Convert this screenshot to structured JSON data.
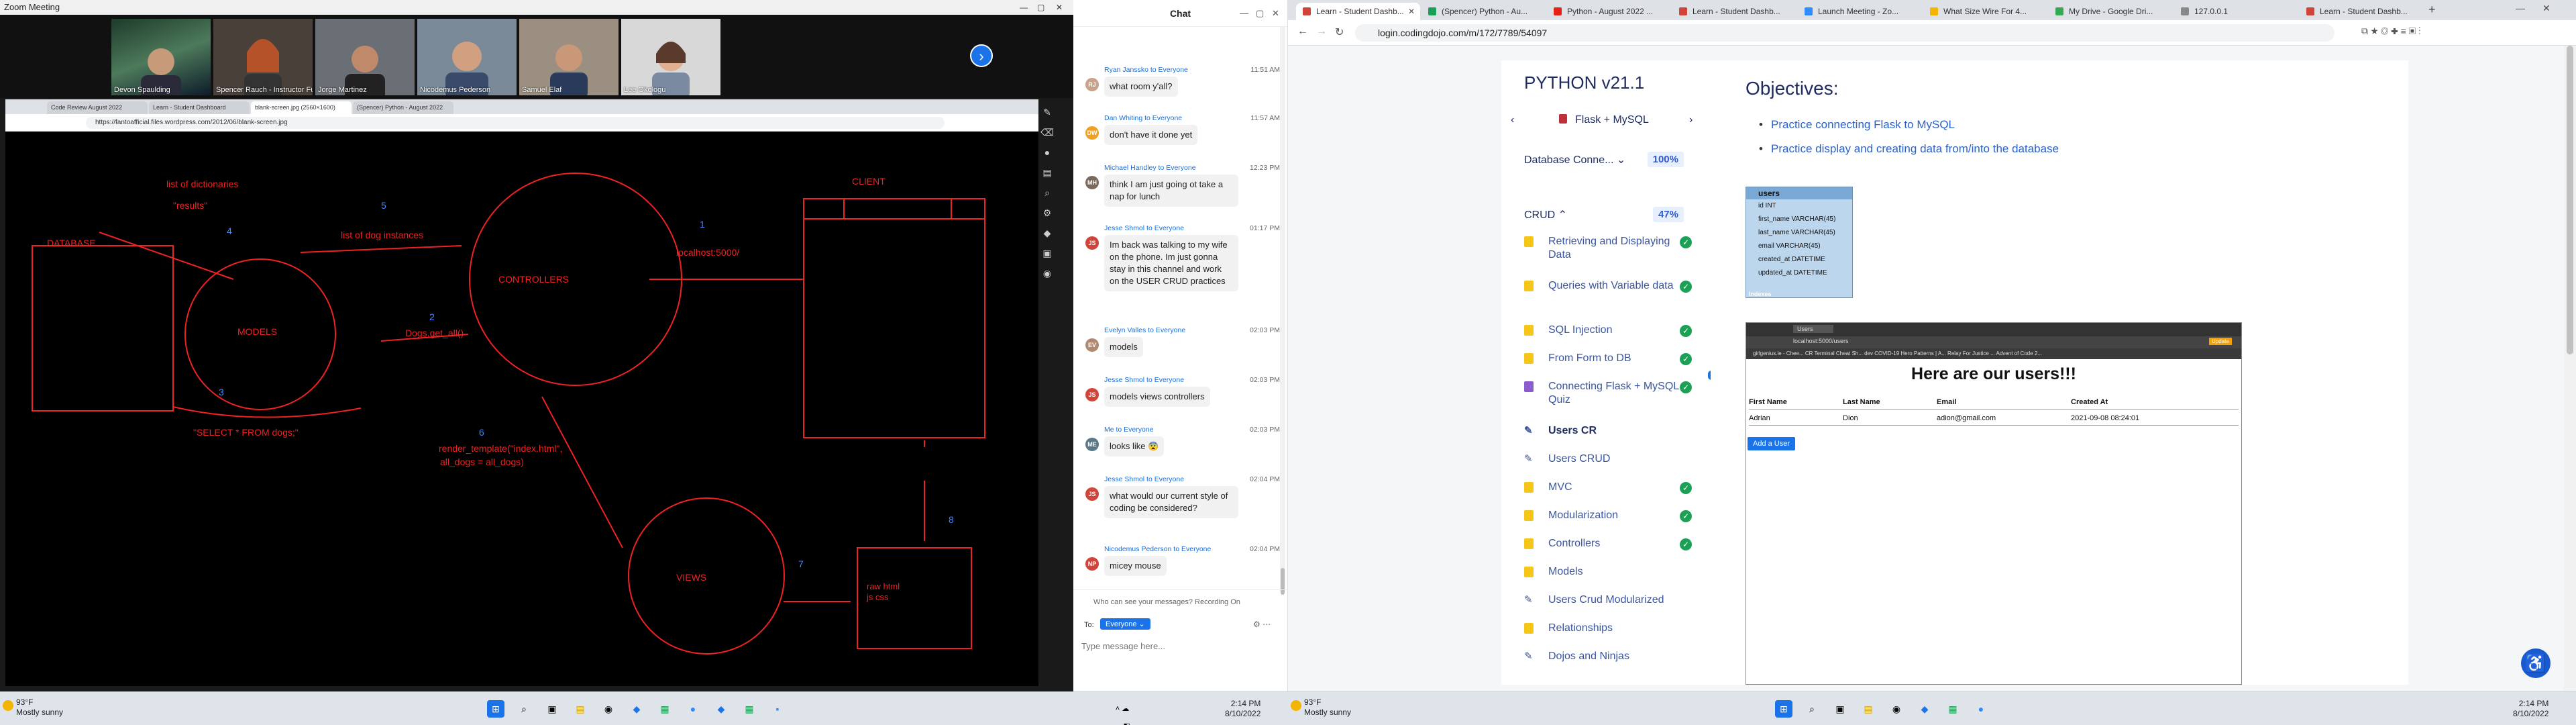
{
  "zoom": {
    "title": "Zoom Meeting",
    "participants": [
      "Devon Spaulding",
      "Spencer Rauch - Instructor Full-Ti...",
      "Jorge Martinez",
      "Nicodemus Pederson",
      "Samuel Elaf",
      "Lee Okologu"
    ]
  },
  "share": {
    "tabs": [
      "Code Review August 2022",
      "Learn - Student Dashboard",
      "blank-screen.jpg (2560×1600)",
      "(Spencer) Python - August 2022"
    ],
    "url": "https://fantoafficial.files.wordpress.com/2012/06/blank-screen.jpg"
  },
  "diagram": {
    "labels": [
      "DATABASE",
      "list of dictionaries",
      "\"results\"",
      "4",
      "5",
      "list  of dog instances",
      "MODELS",
      "CONTROLLERS",
      "1",
      "localhost:5000/",
      "CLIENT",
      "2",
      "Dogs.get_all()",
      "3",
      "\"SELECT * FROM dogs;\"",
      "6",
      "render_template(\"index.html\",",
      "all_dogs = all_dogs)",
      "VIEWS",
      "7",
      "8",
      "raw html  js  css"
    ]
  },
  "chat": {
    "title": "Chat",
    "messages": [
      {
        "from": "Ryan Janssko to Everyone",
        "time": "11:51 AM",
        "initials": "RJ",
        "text": "what room y'all?"
      },
      {
        "from": "Dan Whiting to Everyone",
        "time": "11:57 AM",
        "initials": "DW",
        "text": "don't have it done yet"
      },
      {
        "from": "Michael Handley to Everyone",
        "time": "12:23 PM",
        "initials": "MH",
        "text": "think I am just going ot take a nap for lunch"
      },
      {
        "from": "Jesse Shmol to Everyone",
        "time": "01:17 PM",
        "initials": "JS",
        "text": "Im back was talking to my wife on the phone. Im just gonna stay in this channel and work on the USER CRUD practices"
      },
      {
        "from": "Evelyn Valles to Everyone",
        "time": "02:03 PM",
        "initials": "EV",
        "text": "models"
      },
      {
        "from": "Jesse Shmol to Everyone",
        "time": "02:03 PM",
        "initials": "JS",
        "text": "models views controllers"
      },
      {
        "from": "Me to Everyone",
        "time": "02:03 PM",
        "initials": "ME",
        "text": "looks like 😨"
      },
      {
        "from": "Jesse Shmol to Everyone",
        "time": "02:04 PM",
        "initials": "JS",
        "text": "what would our current style of coding be considered?"
      },
      {
        "from": "Nicodemus Pederson to Everyone",
        "time": "02:04 PM",
        "initials": "NP",
        "text": "micey mouse"
      }
    ],
    "visibility_note": "Who can see your messages? Recording On",
    "to_label": "To:",
    "recipient": "Everyone ⌄",
    "placeholder": "Type message here..."
  },
  "browser": {
    "tabs": [
      "Learn - Student Dashb...",
      "(Spencer) Python - Au...",
      "Python - August 2022 ...",
      "Learn - Student Dashb...",
      "Launch Meeting - Zo...",
      "What Size Wire For 4...",
      "My Drive - Google Dri...",
      "127.0.0.1",
      "Learn - Student Dashb..."
    ],
    "url": "login.codingdojo.com/m/172/7789/54097"
  },
  "learn": {
    "course_title": "PYTHON v21.1",
    "section_title": "Flask + MySQL",
    "chapters": [
      {
        "title": "Database Conne... ⌄",
        "progress": "100%"
      },
      {
        "title": "CRUD ⌃",
        "progress": "47%"
      }
    ],
    "lessons": [
      {
        "title": "Retrieving and Displaying Data",
        "type": "doc",
        "done": true
      },
      {
        "title": "Queries with Variable data",
        "type": "doc",
        "done": true
      },
      {
        "title": "SQL Injection",
        "type": "doc",
        "done": true
      },
      {
        "title": "From Form to DB",
        "type": "doc",
        "done": true
      },
      {
        "title": "Connecting Flask + MySQL Quiz",
        "type": "quiz",
        "done": true
      },
      {
        "title": "Users CR",
        "type": "assignment",
        "done": false,
        "active": true
      },
      {
        "title": "Users CRUD",
        "type": "assignment",
        "done": false
      },
      {
        "title": "MVC",
        "type": "doc",
        "done": true
      },
      {
        "title": "Modularization",
        "type": "doc",
        "done": true
      },
      {
        "title": "Controllers",
        "type": "doc",
        "done": true
      },
      {
        "title": "Models",
        "type": "doc",
        "done": false
      },
      {
        "title": "Users Crud Modularized",
        "type": "assignment",
        "done": false
      },
      {
        "title": "Relationships",
        "type": "doc",
        "done": false
      },
      {
        "title": "Dojos and Ninjas",
        "type": "assignment",
        "done": false
      }
    ],
    "objectives_heading": "Objectives:",
    "objectives": [
      "Practice connecting Flask to MySQL",
      "Practice display and creating data from/into the database"
    ],
    "erd": {
      "table": "users",
      "fields": [
        "id INT",
        "first_name VARCHAR(45)",
        "last_name VARCHAR(45)",
        "email VARCHAR(45)",
        "created_at DATETIME",
        "updated_at DATETIME"
      ],
      "indexes": "Indexes"
    },
    "example": {
      "tab": "Users",
      "url": "localhost:5000/users",
      "update": "Update",
      "bookmarks": "girlgenius.ie - Chee...   CR   Terminal Cheat Sh...   dev   COVID-19   Hero Patterns | A...   Relay For Justice ...   Advent of Code 2...",
      "heading": "Here are our users!!!",
      "columns": [
        "First Name",
        "Last Name",
        "Email",
        "Created At"
      ],
      "rows": [
        {
          "first": "Adrian",
          "last": "Dion",
          "email": "adion@gmail.com",
          "created": "2021-09-08 08:24:01"
        }
      ],
      "add_button": "Add a User"
    }
  },
  "taskbar": {
    "temp": "93°F",
    "weather": "Mostly sunny",
    "time": "2:14 PM",
    "date": "8/10/2022"
  }
}
